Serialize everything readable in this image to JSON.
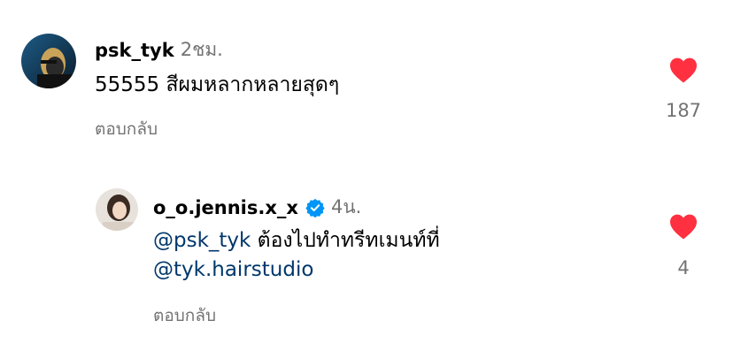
{
  "comments": [
    {
      "username": "psk_tyk",
      "time": "2ชม.",
      "text": "55555 สีผมหลากหลายสุดๆ",
      "reply_label": "ตอบกลับ",
      "likes": "187",
      "avatar_icon": "profile-photo-dark"
    },
    {
      "username": "o_o.jennis.x_x",
      "verified": true,
      "time": "4น.",
      "mention_1": "@psk_tyk",
      "text": "ต้องไปทำทรีทเมนท์ที่",
      "mention_2": "@tyk.hairstudio",
      "reply_label": "ตอบกลับ",
      "likes": "4",
      "avatar_icon": "profile-photo-light"
    }
  ],
  "colors": {
    "heart": "#ff3040",
    "verified": "#0095f6",
    "mention": "#00376b",
    "secondary": "#737373"
  }
}
